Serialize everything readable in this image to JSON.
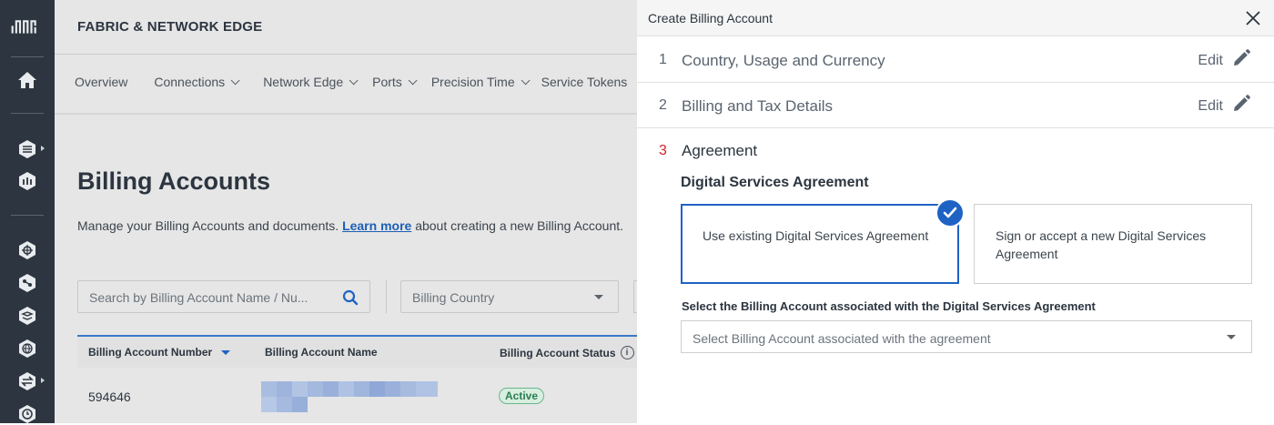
{
  "app": {
    "brand": "FABRIC & NETWORK EDGE",
    "nav": [
      "Overview",
      "Connections",
      "Network Edge",
      "Ports",
      "Precision Time",
      "Service Tokens"
    ],
    "page_title": "Billing Accounts",
    "description_prefix": "Manage your Billing Accounts and documents. ",
    "description_link": "Learn more",
    "description_suffix": " about creating a new Billing Account.",
    "search_placeholder": "Search by Billing Account Name / Nu...",
    "country_placeholder": "Billing Country",
    "table": {
      "headers": [
        "Billing Account Number",
        "Billing Account Name",
        "Billing Account Status"
      ],
      "rows": [
        {
          "number": "594646",
          "status": "Active"
        }
      ]
    }
  },
  "drawer": {
    "title": "Create Billing Account",
    "steps": [
      {
        "num": "1",
        "label": "Country, Usage and Currency",
        "action": "Edit"
      },
      {
        "num": "2",
        "label": "Billing and Tax Details",
        "action": "Edit"
      },
      {
        "num": "3",
        "label": "Agreement"
      }
    ],
    "dsa_title": "Digital Services Agreement",
    "options": [
      {
        "text": "Use existing Digital Services Agreement",
        "selected": true
      },
      {
        "text": "Sign or accept a new Digital Services Agreement",
        "selected": false
      }
    ],
    "select_label": "Select the Billing Account associated with the Digital Services Agreement",
    "select_placeholder": "Select Billing Account associated with the agreement"
  },
  "colors": {
    "accent": "#1e63c4",
    "active_step": "#d2202f",
    "rail": "#2d3640"
  },
  "icons": [
    "equinix-logo-icon",
    "home-icon",
    "fabric-icon",
    "network-edge-icon",
    "connections-icon",
    "nodes-icon",
    "layers-icon",
    "globe-icon",
    "swap-icon",
    "clock-icon",
    "search-icon",
    "pencil-icon",
    "close-icon",
    "checkmark-icon"
  ]
}
